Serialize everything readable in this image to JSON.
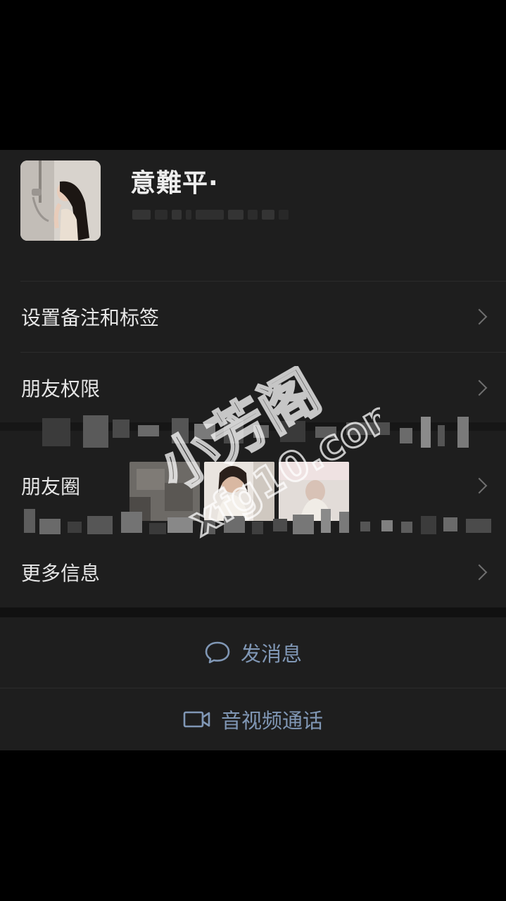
{
  "profile": {
    "name": "意難平·"
  },
  "menu": {
    "remark": "设置备注和标签",
    "permissions": "朋友权限",
    "moments": "朋友圈",
    "more_info": "更多信息"
  },
  "actions": {
    "message": "发消息",
    "call": "音视频通话"
  },
  "watermark": {
    "chinese": "小芳阁",
    "domain": "xfg10.com"
  },
  "colors": {
    "background": "#1e1e1e",
    "action_blue": "#8097b5"
  }
}
